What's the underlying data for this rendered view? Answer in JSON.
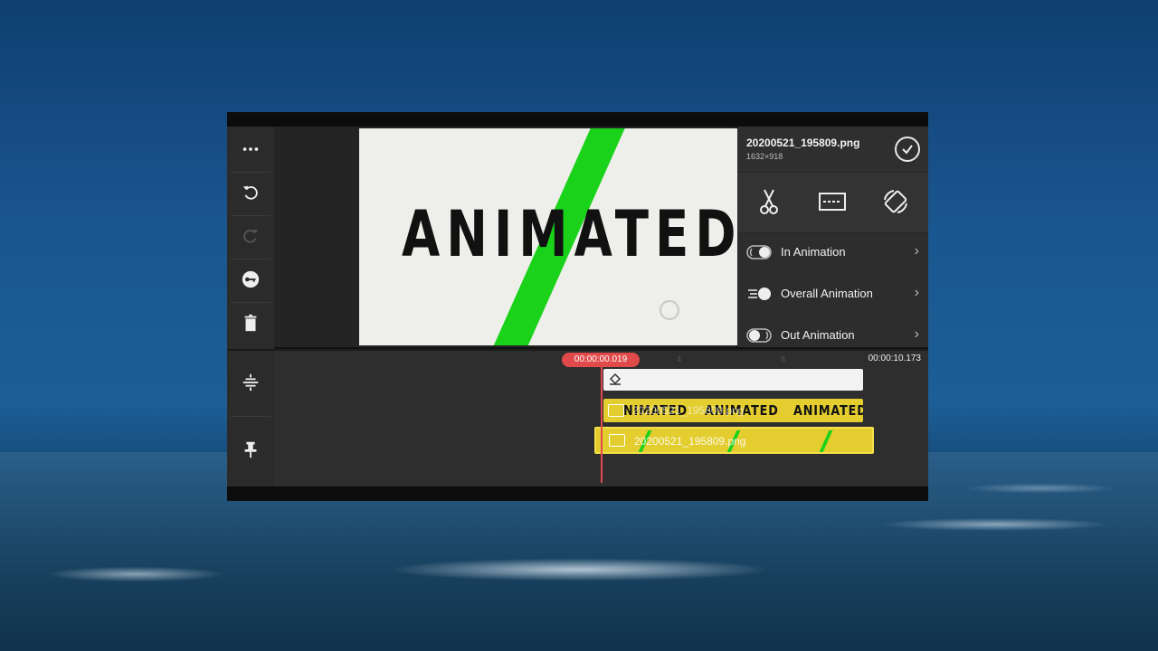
{
  "sidebar": {
    "items": [
      {
        "name": "more-icon"
      },
      {
        "name": "undo-icon"
      },
      {
        "name": "redo-icon"
      },
      {
        "name": "key-icon"
      },
      {
        "name": "delete-icon"
      },
      {
        "name": "align-icon"
      },
      {
        "name": "pin-icon"
      }
    ]
  },
  "preview": {
    "text": "ANIMATED",
    "stripe_color": "#1bd21b"
  },
  "panel": {
    "file_name": "20200521_195809.png",
    "resolution": "1632×918",
    "tools": [
      {
        "name": "scissors-icon"
      },
      {
        "name": "crop-icon"
      },
      {
        "name": "rotate-icon"
      }
    ],
    "menu": [
      {
        "label": "In Animation",
        "icon": "in-animation-icon"
      },
      {
        "label": "Overall Animation",
        "icon": "overall-animation-icon"
      },
      {
        "label": "Out Animation",
        "icon": "out-animation-icon"
      }
    ]
  },
  "timeline": {
    "current_time": "00:00:00.019",
    "end_time": "00:00:10.173",
    "ticks": [
      "4",
      "8"
    ],
    "text_track": {
      "label": "20200521_195809.png",
      "text_repeats": [
        "NIMATED",
        "ANIMATED",
        "ANIMATED"
      ]
    },
    "image_track": {
      "label": "20200521_195809.png"
    }
  }
}
